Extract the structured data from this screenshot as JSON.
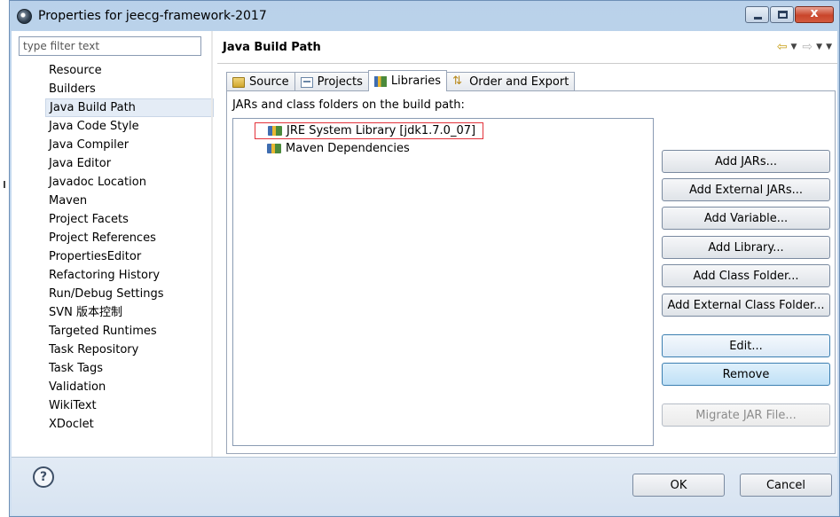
{
  "window": {
    "title": "Properties for jeecg-framework-2017"
  },
  "filter": {
    "placeholder": "type filter text"
  },
  "nav": {
    "items": [
      {
        "label": "Resource"
      },
      {
        "label": "Builders"
      },
      {
        "label": "Java Build Path",
        "selected": true
      },
      {
        "label": "Java Code Style"
      },
      {
        "label": "Java Compiler"
      },
      {
        "label": "Java Editor"
      },
      {
        "label": "Javadoc Location"
      },
      {
        "label": "Maven"
      },
      {
        "label": "Project Facets"
      },
      {
        "label": "Project References"
      },
      {
        "label": "PropertiesEditor"
      },
      {
        "label": "Refactoring History"
      },
      {
        "label": "Run/Debug Settings"
      },
      {
        "label": "SVN 版本控制"
      },
      {
        "label": "Targeted Runtimes"
      },
      {
        "label": "Task Repository"
      },
      {
        "label": "Task Tags"
      },
      {
        "label": "Validation"
      },
      {
        "label": "WikiText"
      },
      {
        "label": "XDoclet"
      }
    ]
  },
  "page": {
    "title": "Java Build Path"
  },
  "tabs": [
    {
      "label": "Source",
      "icon": "source-folder-icon"
    },
    {
      "label": "Projects",
      "icon": "projects-icon"
    },
    {
      "label": "Libraries",
      "icon": "library-icon",
      "active": true
    },
    {
      "label": "Order and Export",
      "icon": "order-export-icon"
    }
  ],
  "libraries": {
    "panel_label": "JARs and class folders on the build path:",
    "entries": [
      {
        "label": "JRE System Library [jdk1.7.0_07]",
        "highlighted": true
      },
      {
        "label": "Maven Dependencies"
      }
    ],
    "buttons": {
      "add_jars": "Add JARs...",
      "add_external_jars": "Add External JARs...",
      "add_variable": "Add Variable...",
      "add_library": "Add Library...",
      "add_class_folder": "Add Class Folder...",
      "add_external_class_folder": "Add External Class Folder...",
      "edit": "Edit...",
      "remove": "Remove",
      "migrate_jar": "Migrate JAR File..."
    }
  },
  "footer": {
    "help": "?",
    "ok": "OK",
    "cancel": "Cancel"
  },
  "window_controls": {
    "close": "x"
  }
}
